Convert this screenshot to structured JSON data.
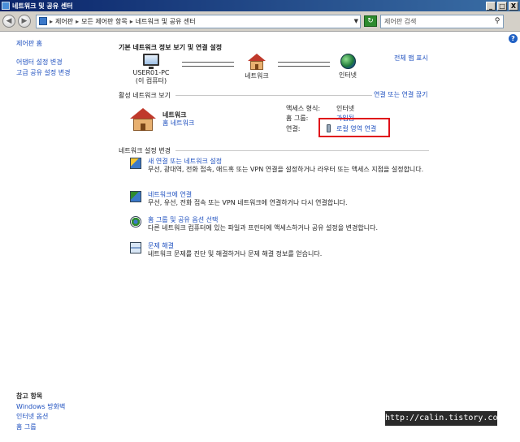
{
  "window": {
    "title": "네트워크 및 공유 센터",
    "min": "_",
    "max": "□",
    "close": "X"
  },
  "address": {
    "back": "◀",
    "forward": "▶",
    "crumbs": [
      "제어판",
      "모든 제어판 항목",
      "네트워크 및 공유 센터"
    ],
    "crumb_sep": "▸",
    "search_placeholder": "제어판 검색"
  },
  "left_pane": {
    "home": "제어판 홈",
    "adapter": "어댑터 설정 변경",
    "sharing": "고급 공유 설정 변경",
    "see_also": "참고 항목",
    "firewall": "Windows 방화벽",
    "internet_options": "인터넷 옵션",
    "homegroup": "홈 그룹"
  },
  "main": {
    "heading": "기본 네트워크 정보 보기 및 연결 설정",
    "full_map": "전체 맵 표시",
    "map": {
      "pc_name": "USER01-PC",
      "pc_sub": "(이 컴퓨터)",
      "network": "네트워크",
      "internet": "인터넷"
    },
    "active_heading": "활성 네트워크 보기",
    "connect_link": "연결 또는 연결 끊기",
    "network": {
      "name": "네트워크",
      "type": "홈 네트워크"
    },
    "props": {
      "access_label": "액세스 형식:",
      "access_value": "인터넷",
      "homegroup_label": "홈 그룹:",
      "homegroup_value": "가입됨",
      "connection_label": "연결:",
      "connection_value": "로컬 영역 연결"
    },
    "change_heading": "네트워크 설정 변경",
    "tasks": [
      {
        "title": "새 연결 또는 네트워크 설정",
        "desc": "무선, 광대역, 전화 접속, 애드혹 또는 VPN 연결을 설정하거나 라우터 또는 액세스 지점을 설정합니다."
      },
      {
        "title": "네트워크에 연결",
        "desc": "무선, 유선, 전화 접속 또는 VPN 네트워크에 연결하거나 다시 연결합니다."
      },
      {
        "title": "홈 그룹 및 공유 옵션 선택",
        "desc": "다른 네트워크 컴퓨터에 있는 파일과 프린터에 액세스하거나 공유 설정을 변경합니다."
      },
      {
        "title": "문제 해결",
        "desc": "네트워크 문제를 진단 및 해결하거나 문제 해결 정보를 얻습니다."
      }
    ]
  },
  "watermark": "http://calin.tistory.com"
}
